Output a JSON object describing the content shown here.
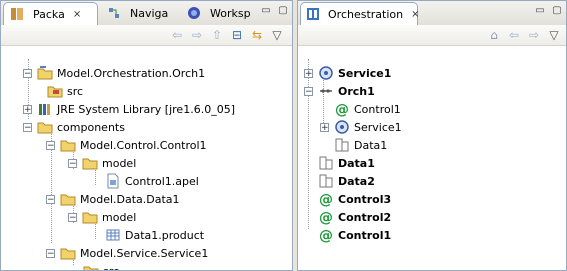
{
  "left": {
    "tabs": [
      {
        "label": "Packa",
        "close": "⨯",
        "active": true
      },
      {
        "label": "Naviga",
        "active": false
      },
      {
        "label": "Worksp",
        "active": false
      }
    ],
    "tree": [
      {
        "label": "Model.Orchestration.Orch1",
        "icon": "project-icon",
        "expand": "−"
      },
      {
        "label": "src",
        "icon": "source-folder-icon",
        "expand": ""
      },
      {
        "label": "JRE System Library [jre1.6.0_05]",
        "icon": "library-icon",
        "expand": "+"
      },
      {
        "label": "components",
        "icon": "folder-icon",
        "expand": "−"
      },
      {
        "label": "Model.Control.Control1",
        "icon": "folder-icon",
        "expand": "−"
      },
      {
        "label": "model",
        "icon": "folder-icon",
        "expand": "−"
      },
      {
        "label": "Control1.apel",
        "icon": "file-icon",
        "expand": ""
      },
      {
        "label": "Model.Data.Data1",
        "icon": "folder-icon",
        "expand": "−"
      },
      {
        "label": "model",
        "icon": "folder-icon",
        "expand": "−"
      },
      {
        "label": "Data1.product",
        "icon": "product-file-icon",
        "expand": ""
      },
      {
        "label": "Model.Service.Service1",
        "icon": "folder-icon",
        "expand": "−"
      },
      {
        "label": "src",
        "icon": "folder-icon",
        "expand": ""
      }
    ]
  },
  "right": {
    "tab": {
      "label": "Orchestration",
      "close": "⨯"
    },
    "tree": [
      {
        "label": "Service1",
        "icon": "service-icon",
        "bold": true,
        "expand": "+"
      },
      {
        "label": "Orch1",
        "icon": "orch-icon",
        "bold": true,
        "expand": "−"
      },
      {
        "label": "Control1",
        "icon": "control-icon",
        "bold": false,
        "expand": ""
      },
      {
        "label": "Service1",
        "icon": "service-icon",
        "bold": false,
        "expand": "+"
      },
      {
        "label": "Data1",
        "icon": "data-icon",
        "bold": false,
        "expand": ""
      },
      {
        "label": "Data1",
        "icon": "data-icon",
        "bold": true,
        "expand": ""
      },
      {
        "label": "Data2",
        "icon": "data-icon",
        "bold": true,
        "expand": ""
      },
      {
        "label": "Control3",
        "icon": "control-icon",
        "bold": true,
        "expand": ""
      },
      {
        "label": "Control2",
        "icon": "control-icon",
        "bold": true,
        "expand": ""
      },
      {
        "label": "Control1",
        "icon": "control-icon",
        "bold": true,
        "expand": ""
      }
    ]
  }
}
